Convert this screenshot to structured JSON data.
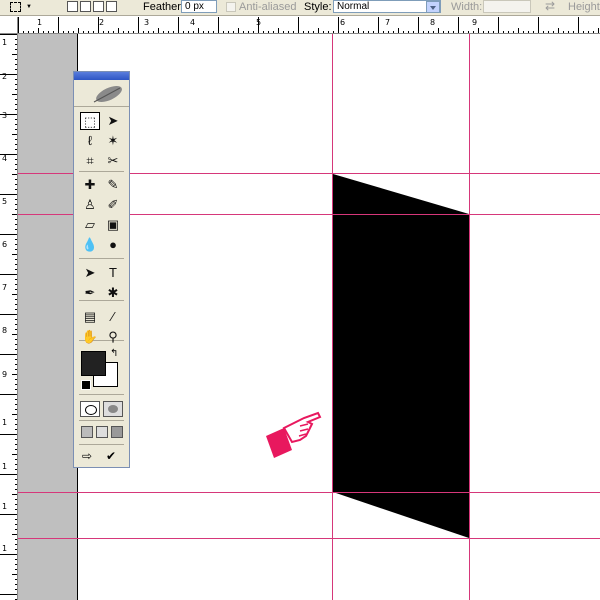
{
  "options_bar": {
    "feather_label": "Feather:",
    "feather_value": "0 px",
    "antialiased_label": "Anti-aliased",
    "style_label": "Style:",
    "style_value": "Normal",
    "width_label": "Width:",
    "height_label": "Height:",
    "width_value": "",
    "height_value": ""
  },
  "rulers": {
    "horizontal_labels": [
      "1",
      "2",
      "3",
      "4",
      "5",
      "6",
      "7",
      "8",
      "9"
    ],
    "vertical_labels": [
      "1",
      "2",
      "3",
      "4",
      "5",
      "6",
      "7",
      "8",
      "9",
      "1",
      "1",
      "1",
      "1"
    ]
  },
  "tools": [
    {
      "name": "rectangular-marquee-tool-icon",
      "glyph": "⬚",
      "selected": true
    },
    {
      "name": "move-tool-icon",
      "glyph": "➤"
    },
    {
      "name": "lasso-tool-icon",
      "glyph": "ℓ"
    },
    {
      "name": "magic-wand-tool-icon",
      "glyph": "✶"
    },
    {
      "name": "crop-tool-icon",
      "glyph": "⌗"
    },
    {
      "name": "slice-tool-icon",
      "glyph": "✂"
    },
    {
      "name": "healing-brush-tool-icon",
      "glyph": "✚"
    },
    {
      "name": "brush-tool-icon",
      "glyph": "✎"
    },
    {
      "name": "clone-stamp-tool-icon",
      "glyph": "♙"
    },
    {
      "name": "history-brush-tool-icon",
      "glyph": "✐"
    },
    {
      "name": "eraser-tool-icon",
      "glyph": "▱"
    },
    {
      "name": "gradient-tool-icon",
      "glyph": "▣"
    },
    {
      "name": "blur-tool-icon",
      "glyph": "💧"
    },
    {
      "name": "dodge-tool-icon",
      "glyph": "●"
    },
    {
      "name": "path-selection-tool-icon",
      "glyph": "➤"
    },
    {
      "name": "type-tool-icon",
      "glyph": "T"
    },
    {
      "name": "pen-tool-icon",
      "glyph": "✒"
    },
    {
      "name": "custom-shape-tool-icon",
      "glyph": "✱"
    },
    {
      "name": "notes-tool-icon",
      "glyph": "▤"
    },
    {
      "name": "eyedropper-tool-icon",
      "glyph": "⁄"
    },
    {
      "name": "hand-tool-icon",
      "glyph": "✋"
    },
    {
      "name": "zoom-tool-icon",
      "glyph": "⚲"
    }
  ],
  "colors": {
    "foreground": "#222222",
    "background": "#ffffff",
    "guide": "#d6377a",
    "cursor_hand": "#e8185e",
    "shape_fill": "#000000"
  }
}
